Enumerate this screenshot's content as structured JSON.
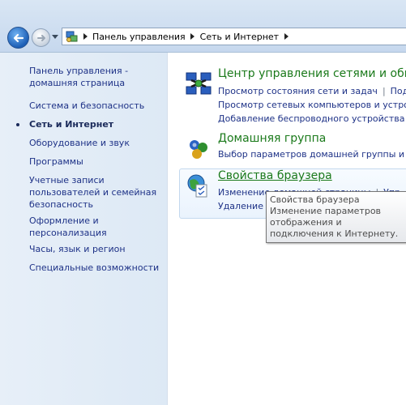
{
  "navigation": {
    "back_icon": "back-arrow-icon",
    "forward_icon": "forward-arrow-icon",
    "history_icon": "chevron-down-icon"
  },
  "address_bar": {
    "icon": "control-panel-icon",
    "crumbs": [
      "Панель управления",
      "Сеть и Интернет"
    ]
  },
  "sidebar": {
    "items": [
      {
        "label": "Панель управления - домашняя страница"
      },
      {
        "label": "Система и безопасность"
      },
      {
        "label": "Сеть и Интернет",
        "active": true
      },
      {
        "label": "Оборудование и звук"
      },
      {
        "label": "Программы"
      },
      {
        "label": "Учетные записи пользователей и семейная безопасность"
      },
      {
        "label": "Оформление и персонализация"
      },
      {
        "label": "Часы, язык и регион"
      },
      {
        "label": "Специальные возможности"
      }
    ]
  },
  "categories": [
    {
      "title": "Центр управления сетями и общ",
      "icon": "network-center-icon",
      "links": [
        {
          "a": "Просмотр состояния сети и задач",
          "b": "Под"
        },
        {
          "a": "Просмотр сетевых компьютеров и устройс"
        },
        {
          "a": "Добавление беспроводного устройства в"
        }
      ]
    },
    {
      "title": "Домашняя группа",
      "icon": "homegroup-icon",
      "links": [
        {
          "a": "Выбор параметров домашней группы и о"
        }
      ]
    },
    {
      "title": "Свойства браузера",
      "icon": "internet-options-icon",
      "links": [
        {
          "a": "Изменение домашней страницы",
          "b": "Упр"
        },
        {
          "a": "Удаление и"
        }
      ]
    }
  ],
  "tooltip": {
    "title": "Свойства браузера",
    "text": "Изменение параметров отображения и подключения к Интернету."
  },
  "colors": {
    "category_title": "#1b7a1b",
    "link": "#1e3287"
  }
}
